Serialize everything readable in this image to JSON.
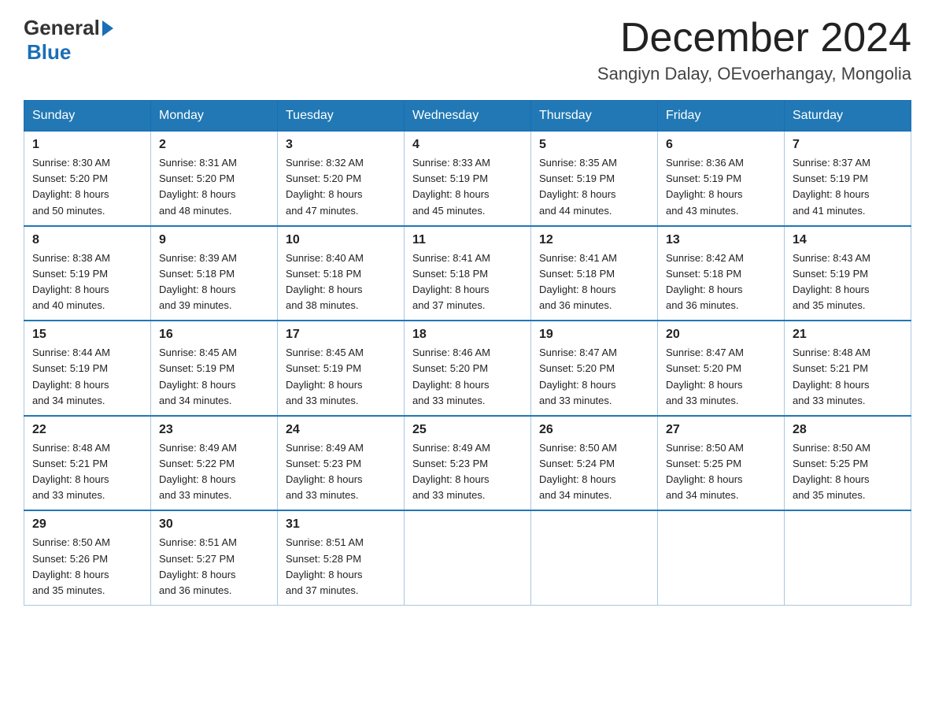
{
  "logo": {
    "general": "General",
    "blue": "Blue"
  },
  "title": {
    "month_year": "December 2024",
    "location": "Sangiyn Dalay, OEvoerhangay, Mongolia"
  },
  "headers": [
    "Sunday",
    "Monday",
    "Tuesday",
    "Wednesday",
    "Thursday",
    "Friday",
    "Saturday"
  ],
  "weeks": [
    [
      {
        "day": "1",
        "info": "Sunrise: 8:30 AM\nSunset: 5:20 PM\nDaylight: 8 hours\nand 50 minutes."
      },
      {
        "day": "2",
        "info": "Sunrise: 8:31 AM\nSunset: 5:20 PM\nDaylight: 8 hours\nand 48 minutes."
      },
      {
        "day": "3",
        "info": "Sunrise: 8:32 AM\nSunset: 5:20 PM\nDaylight: 8 hours\nand 47 minutes."
      },
      {
        "day": "4",
        "info": "Sunrise: 8:33 AM\nSunset: 5:19 PM\nDaylight: 8 hours\nand 45 minutes."
      },
      {
        "day": "5",
        "info": "Sunrise: 8:35 AM\nSunset: 5:19 PM\nDaylight: 8 hours\nand 44 minutes."
      },
      {
        "day": "6",
        "info": "Sunrise: 8:36 AM\nSunset: 5:19 PM\nDaylight: 8 hours\nand 43 minutes."
      },
      {
        "day": "7",
        "info": "Sunrise: 8:37 AM\nSunset: 5:19 PM\nDaylight: 8 hours\nand 41 minutes."
      }
    ],
    [
      {
        "day": "8",
        "info": "Sunrise: 8:38 AM\nSunset: 5:19 PM\nDaylight: 8 hours\nand 40 minutes."
      },
      {
        "day": "9",
        "info": "Sunrise: 8:39 AM\nSunset: 5:18 PM\nDaylight: 8 hours\nand 39 minutes."
      },
      {
        "day": "10",
        "info": "Sunrise: 8:40 AM\nSunset: 5:18 PM\nDaylight: 8 hours\nand 38 minutes."
      },
      {
        "day": "11",
        "info": "Sunrise: 8:41 AM\nSunset: 5:18 PM\nDaylight: 8 hours\nand 37 minutes."
      },
      {
        "day": "12",
        "info": "Sunrise: 8:41 AM\nSunset: 5:18 PM\nDaylight: 8 hours\nand 36 minutes."
      },
      {
        "day": "13",
        "info": "Sunrise: 8:42 AM\nSunset: 5:18 PM\nDaylight: 8 hours\nand 36 minutes."
      },
      {
        "day": "14",
        "info": "Sunrise: 8:43 AM\nSunset: 5:19 PM\nDaylight: 8 hours\nand 35 minutes."
      }
    ],
    [
      {
        "day": "15",
        "info": "Sunrise: 8:44 AM\nSunset: 5:19 PM\nDaylight: 8 hours\nand 34 minutes."
      },
      {
        "day": "16",
        "info": "Sunrise: 8:45 AM\nSunset: 5:19 PM\nDaylight: 8 hours\nand 34 minutes."
      },
      {
        "day": "17",
        "info": "Sunrise: 8:45 AM\nSunset: 5:19 PM\nDaylight: 8 hours\nand 33 minutes."
      },
      {
        "day": "18",
        "info": "Sunrise: 8:46 AM\nSunset: 5:20 PM\nDaylight: 8 hours\nand 33 minutes."
      },
      {
        "day": "19",
        "info": "Sunrise: 8:47 AM\nSunset: 5:20 PM\nDaylight: 8 hours\nand 33 minutes."
      },
      {
        "day": "20",
        "info": "Sunrise: 8:47 AM\nSunset: 5:20 PM\nDaylight: 8 hours\nand 33 minutes."
      },
      {
        "day": "21",
        "info": "Sunrise: 8:48 AM\nSunset: 5:21 PM\nDaylight: 8 hours\nand 33 minutes."
      }
    ],
    [
      {
        "day": "22",
        "info": "Sunrise: 8:48 AM\nSunset: 5:21 PM\nDaylight: 8 hours\nand 33 minutes."
      },
      {
        "day": "23",
        "info": "Sunrise: 8:49 AM\nSunset: 5:22 PM\nDaylight: 8 hours\nand 33 minutes."
      },
      {
        "day": "24",
        "info": "Sunrise: 8:49 AM\nSunset: 5:23 PM\nDaylight: 8 hours\nand 33 minutes."
      },
      {
        "day": "25",
        "info": "Sunrise: 8:49 AM\nSunset: 5:23 PM\nDaylight: 8 hours\nand 33 minutes."
      },
      {
        "day": "26",
        "info": "Sunrise: 8:50 AM\nSunset: 5:24 PM\nDaylight: 8 hours\nand 34 minutes."
      },
      {
        "day": "27",
        "info": "Sunrise: 8:50 AM\nSunset: 5:25 PM\nDaylight: 8 hours\nand 34 minutes."
      },
      {
        "day": "28",
        "info": "Sunrise: 8:50 AM\nSunset: 5:25 PM\nDaylight: 8 hours\nand 35 minutes."
      }
    ],
    [
      {
        "day": "29",
        "info": "Sunrise: 8:50 AM\nSunset: 5:26 PM\nDaylight: 8 hours\nand 35 minutes."
      },
      {
        "day": "30",
        "info": "Sunrise: 8:51 AM\nSunset: 5:27 PM\nDaylight: 8 hours\nand 36 minutes."
      },
      {
        "day": "31",
        "info": "Sunrise: 8:51 AM\nSunset: 5:28 PM\nDaylight: 8 hours\nand 37 minutes."
      },
      {
        "day": "",
        "info": ""
      },
      {
        "day": "",
        "info": ""
      },
      {
        "day": "",
        "info": ""
      },
      {
        "day": "",
        "info": ""
      }
    ]
  ]
}
